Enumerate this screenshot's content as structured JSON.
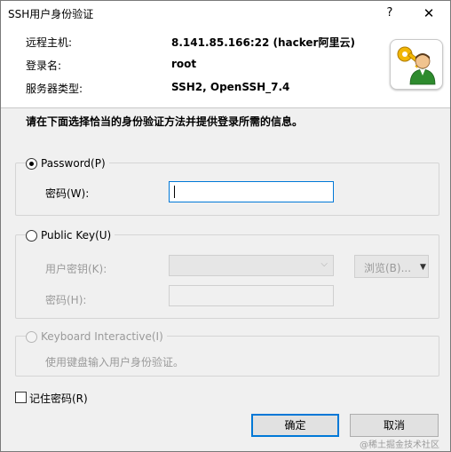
{
  "window": {
    "title": "SSH用户身份验证",
    "help_label": "?",
    "close_label": "✕"
  },
  "info": {
    "host_label": "远程主机:",
    "host_value": "8.141.85.166:22 (hacker阿里云)",
    "login_label": "登录名:",
    "login_value": "root",
    "server_type_label": "服务器类型:",
    "server_type_value": "SSH2, OpenSSH_7.4"
  },
  "instruction": "请在下面选择恰当的身份验证方法并提供登录所需的信息。",
  "password_method": {
    "label": "Password(P)",
    "selected": true,
    "password_label": "密码(W):",
    "password_value": ""
  },
  "public_key_method": {
    "label": "Public Key(U)",
    "selected": false,
    "user_key_label": "用户密钥(K):",
    "user_key_value": "",
    "browse_label": "浏览(B)...",
    "passphrase_label": "密码(H):",
    "passphrase_value": ""
  },
  "keyboard_method": {
    "label": "Keyboard Interactive(I)",
    "selected": false,
    "description": "使用键盘输入用户身份验证。"
  },
  "remember_password": {
    "label": "记住密码(R)",
    "checked": false
  },
  "buttons": {
    "ok_label": "确定",
    "cancel_label": "取消"
  },
  "watermark": "@稀土掘金技术社区",
  "colors": {
    "focus_border": "#0078d7",
    "disabled_text": "#9a9a9a",
    "info_background": "#ffffff",
    "dialog_background": "#f0f0f0"
  },
  "icons": {
    "logo": "key-user-icon",
    "combo_arrow": "chevron-down-icon",
    "browse_arrow": "triangle-down-icon"
  }
}
